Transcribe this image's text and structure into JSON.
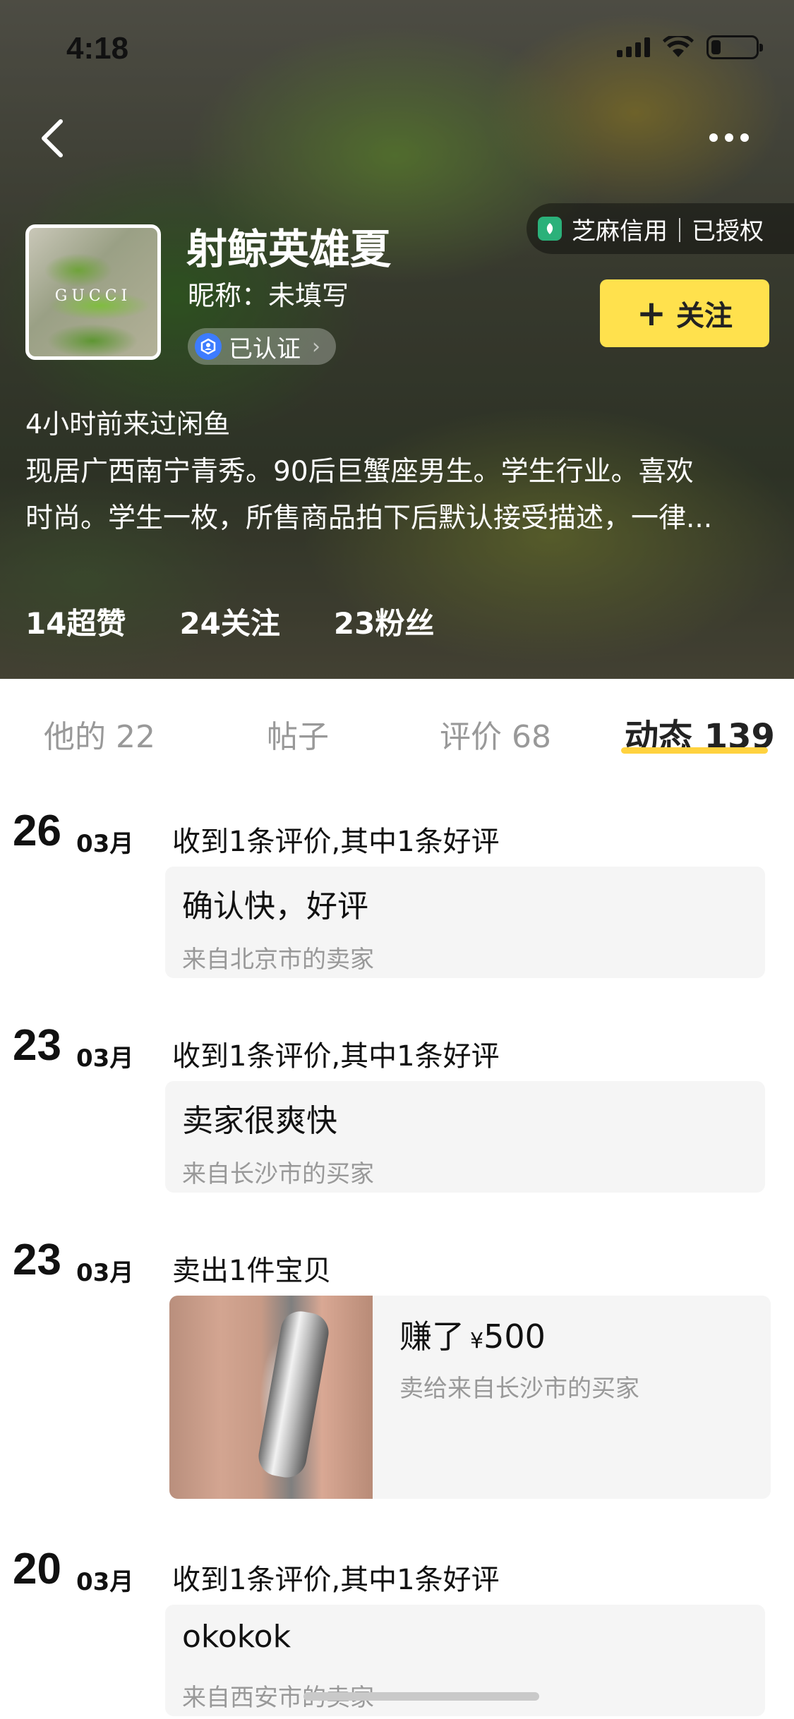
{
  "status": {
    "time": "4:18"
  },
  "profile": {
    "name": "射鲸英雄夏",
    "nickname": "昵称：未填写",
    "verified_label": "已认证",
    "credit_label": "芝麻信用｜已授权",
    "follow_label": "关注",
    "avatar_brand": "GUCCI",
    "last_seen": "4小时前来过闲鱼",
    "bio_line1": "现居广西南宁青秀。90后巨蟹座男生。学生行业。喜欢",
    "bio_line2": "时尚。学生一枚，所售商品拍下后默认接受描述，一律...",
    "stats": {
      "likes": "14超赞",
      "following": "24关注",
      "fans": "23粉丝"
    }
  },
  "tabs": [
    {
      "label": "他的 22"
    },
    {
      "label": "帖子"
    },
    {
      "label": "评价 68"
    },
    {
      "label": "动态 139"
    }
  ],
  "feed": [
    {
      "day": "26",
      "month": "03月",
      "title": "收到1条评价,其中1条好评",
      "text": "确认快，好评",
      "sub": "来自北京市的卖家"
    },
    {
      "day": "23",
      "month": "03月",
      "title": "收到1条评价,其中1条好评",
      "text": "卖家很爽快",
      "sub": "来自长沙市的买家"
    },
    {
      "day": "23",
      "month": "03月",
      "title": "卖出1件宝贝",
      "earn_prefix": "赚了",
      "currency": "¥",
      "amount": "500",
      "sub": "卖给来自长沙市的买家"
    },
    {
      "day": "20",
      "month": "03月",
      "title": "收到1条评价,其中1条好评",
      "text": "okokok",
      "sub": "来自西安市的卖家"
    }
  ],
  "colors": {
    "accent": "#ffe14d",
    "indicator": "#ffd23f",
    "verified": "#3d7cff",
    "credit": "#2bb17a"
  }
}
